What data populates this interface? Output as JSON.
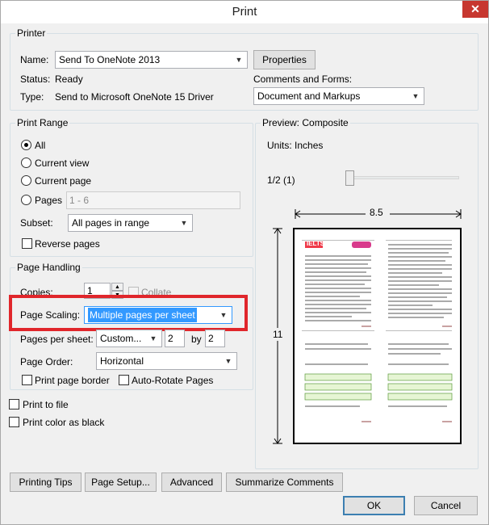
{
  "window": {
    "title": "Print",
    "close_label": "✕"
  },
  "printer": {
    "group_label": "Printer",
    "name_label": "Name:",
    "name_value": "Send To OneNote 2013",
    "properties_label": "Properties",
    "status_label": "Status:",
    "status_value": "Ready",
    "type_label": "Type:",
    "type_value": "Send to Microsoft OneNote 15 Driver",
    "comments_label": "Comments and Forms:",
    "comments_value": "Document and Markups"
  },
  "print_range": {
    "group_label": "Print Range",
    "all_label": "All",
    "current_view_label": "Current view",
    "current_page_label": "Current page",
    "pages_label": "Pages",
    "pages_value": "1 - 6",
    "subset_label": "Subset:",
    "subset_value": "All pages in range",
    "reverse_label": "Reverse pages"
  },
  "page_handling": {
    "group_label": "Page Handling",
    "copies_label": "Copies:",
    "copies_value": "1",
    "collate_label": "Collate",
    "scaling_label": "Page Scaling:",
    "scaling_value": "Multiple pages per sheet",
    "pages_per_sheet_label": "Pages per sheet:",
    "pages_per_sheet_value": "Custom...",
    "pps_x": "2",
    "by_label": "by",
    "pps_y": "2",
    "order_label": "Page Order:",
    "order_value": "Horizontal",
    "border_label": "Print page border",
    "autorotate_label": "Auto-Rotate Pages"
  },
  "options": {
    "print_to_file_label": "Print to file",
    "color_black_label": "Print color as black"
  },
  "preview": {
    "group_label": "Preview: Composite",
    "units_label": "Units: Inches",
    "page_counter": "1/2 (1)",
    "width_dim": "8.5",
    "height_dim": "11",
    "logo_text": "IELTS",
    "slider_position": 0.0
  },
  "buttons": {
    "tips": "Printing Tips",
    "setup": "Page Setup...",
    "advanced": "Advanced",
    "summarize": "Summarize Comments",
    "ok": "OK",
    "cancel": "Cancel"
  },
  "colors": {
    "highlight": "#e0262b",
    "selection": "#3399ff",
    "title_bar": "#ffffff",
    "close": "#c7372f"
  }
}
